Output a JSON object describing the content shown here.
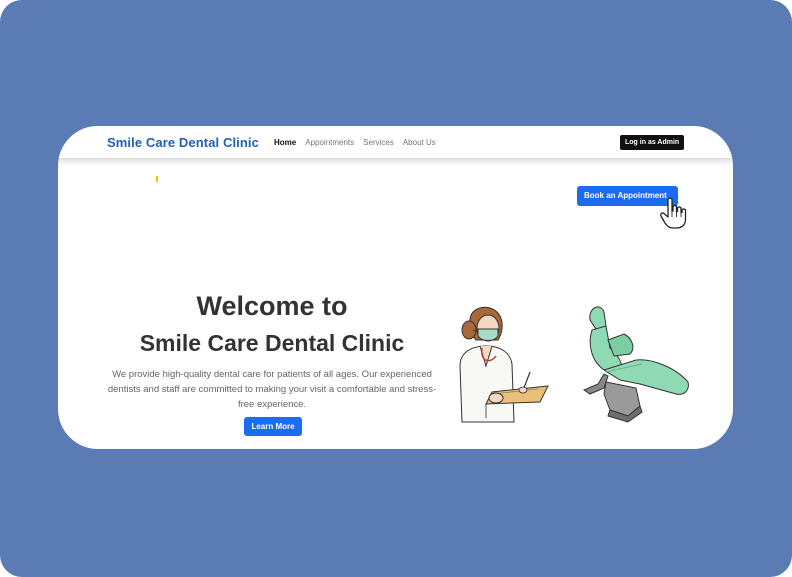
{
  "navbar": {
    "brand": "Smile Care Dental Clinic",
    "links": [
      {
        "label": "Home",
        "active": true
      },
      {
        "label": "Appointments",
        "active": false
      },
      {
        "label": "Services",
        "active": false
      },
      {
        "label": "About Us",
        "active": false
      }
    ],
    "admin_label": "Log in as Admin"
  },
  "hero": {
    "book_label": "Book an Appointment",
    "title_line1": "Welcome to",
    "title_line2": "Smile Care Dental Clinic",
    "description": "We provide high-quality dental care for patients of all ages. Our experienced dentists and staff are committed to making your visit a comfortable and stress-free experience.",
    "learn_more_label": "Learn More"
  },
  "colors": {
    "background": "#5a7bb4",
    "brand": "#1f5fbf",
    "primary_button": "#1b6cf0",
    "admin_button": "#111111",
    "chair": "#8fd9b4"
  },
  "icons": [
    "pointer-hand-icon",
    "dentist-illustration",
    "dental-chair-illustration"
  ]
}
